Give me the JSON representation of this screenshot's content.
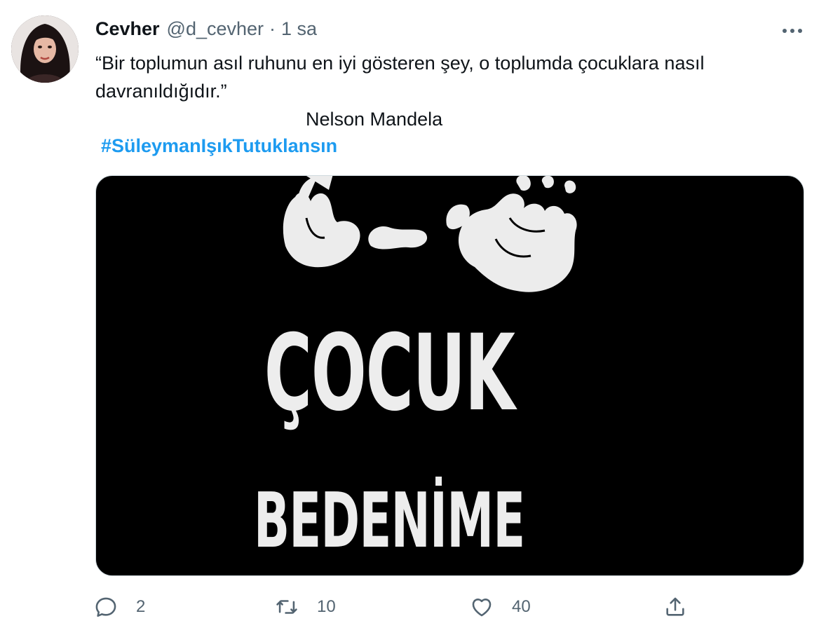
{
  "tweet": {
    "author_name": "Cevher",
    "author_handle": "@d_cevher",
    "separator": "·",
    "timestamp": "1 sa",
    "text_line1": "“Bir toplumun asıl ruhunu en iyi gösteren şey, o toplumda çocuklara nasıl",
    "text_line2": "davranıldığıdır.”",
    "text_line3": "Nelson Mandela",
    "hashtag": "#SüleymanIşıkTutuklansın"
  },
  "media": {
    "line1": "ÇOCUK",
    "line2": "BEDENİME"
  },
  "actions": {
    "reply_count": "2",
    "retweet_count": "10",
    "like_count": "40"
  },
  "colors": {
    "accent": "#1d9bf0",
    "secondary_text": "#536471",
    "text": "#0f1419"
  },
  "icons": {
    "more": "more-horizontal-icon",
    "reply": "reply-icon",
    "retweet": "retweet-icon",
    "like": "heart-icon",
    "share": "share-icon"
  }
}
